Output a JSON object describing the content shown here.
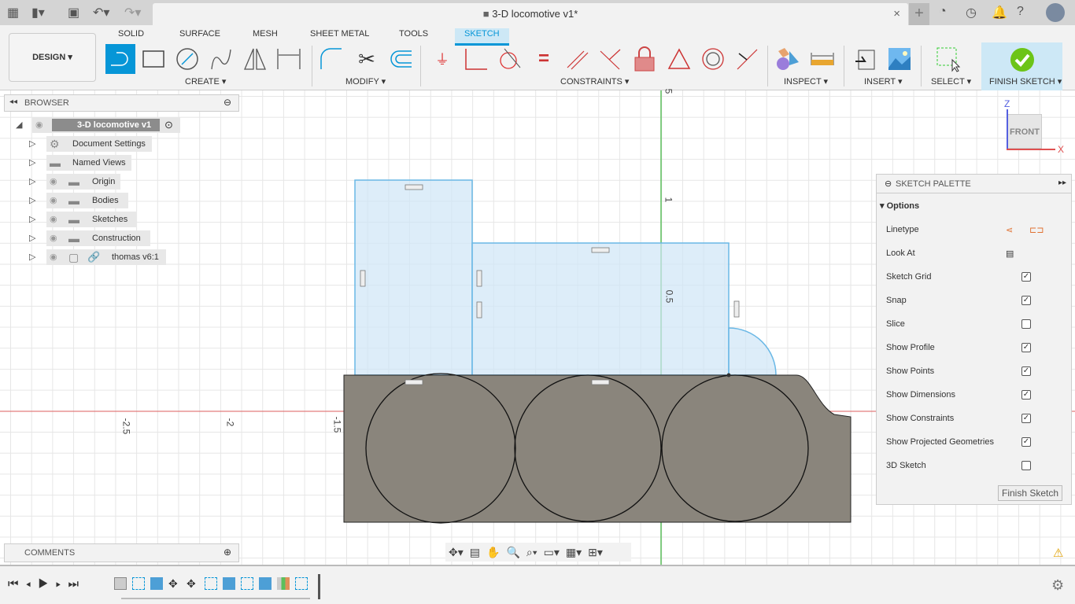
{
  "window": {
    "title": "3-D locomotive v1*"
  },
  "toolbar": {
    "workspace": "DESIGN",
    "tabs": [
      "SOLID",
      "SURFACE",
      "MESH",
      "SHEET METAL",
      "TOOLS",
      "SKETCH"
    ],
    "active_tab": "SKETCH",
    "groups": {
      "create": "CREATE",
      "modify": "MODIFY",
      "constraints": "CONSTRAINTS",
      "inspect": "INSPECT",
      "insert": "INSERT",
      "select": "SELECT",
      "finish": "FINISH SKETCH"
    }
  },
  "browser": {
    "title": "BROWSER",
    "root": "3-D locomotive v1",
    "items": [
      "Document Settings",
      "Named Views",
      "Origin",
      "Bodies",
      "Sketches",
      "Construction",
      "thomas v6:1"
    ]
  },
  "comments": {
    "title": "COMMENTS"
  },
  "viewcube": {
    "face": "FRONT",
    "z": "Z",
    "x": "X"
  },
  "axis_labels": {
    "x": [
      "-2.5",
      "-2",
      "-1.5"
    ],
    "y": [
      "5",
      "1",
      "0.5"
    ]
  },
  "palette": {
    "title": "SKETCH PALETTE",
    "section": "Options",
    "rows": [
      {
        "label": "Linetype",
        "type": "icons"
      },
      {
        "label": "Look At",
        "type": "icon"
      },
      {
        "label": "Sketch Grid",
        "checked": true
      },
      {
        "label": "Snap",
        "checked": true
      },
      {
        "label": "Slice",
        "checked": false
      },
      {
        "label": "Show Profile",
        "checked": true
      },
      {
        "label": "Show Points",
        "checked": true
      },
      {
        "label": "Show Dimensions",
        "checked": true
      },
      {
        "label": "Show Constraints",
        "checked": true
      },
      {
        "label": "Show Projected Geometries",
        "checked": true
      },
      {
        "label": "3D Sketch",
        "checked": false
      }
    ],
    "finish_button": "Finish Sketch"
  },
  "colors": {
    "accent": "#0696d7",
    "profile": "#cfe6f7",
    "body": "#8a857c",
    "x_axis": "#e05050",
    "y_axis": "#4caf50",
    "finish": "#6cc417"
  }
}
